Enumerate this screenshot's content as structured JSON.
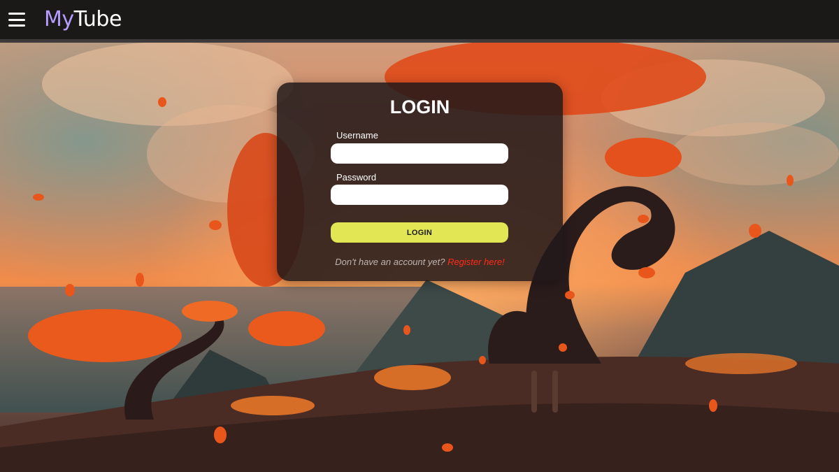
{
  "header": {
    "brand_my": "My",
    "brand_tube": "Tube",
    "menu_icon": "hamburger-menu-icon"
  },
  "login": {
    "title": "LOGIN",
    "username_label": "Username",
    "username_value": "",
    "password_label": "Password",
    "password_value": "",
    "submit_label": "LOGIN",
    "register_prompt": "Don't have an account yet?",
    "register_link": "Register here!"
  },
  "colors": {
    "brand_accent": "#b79cff",
    "button": "#e2e554",
    "link": "#ff2a1a",
    "card": "#22181a"
  }
}
